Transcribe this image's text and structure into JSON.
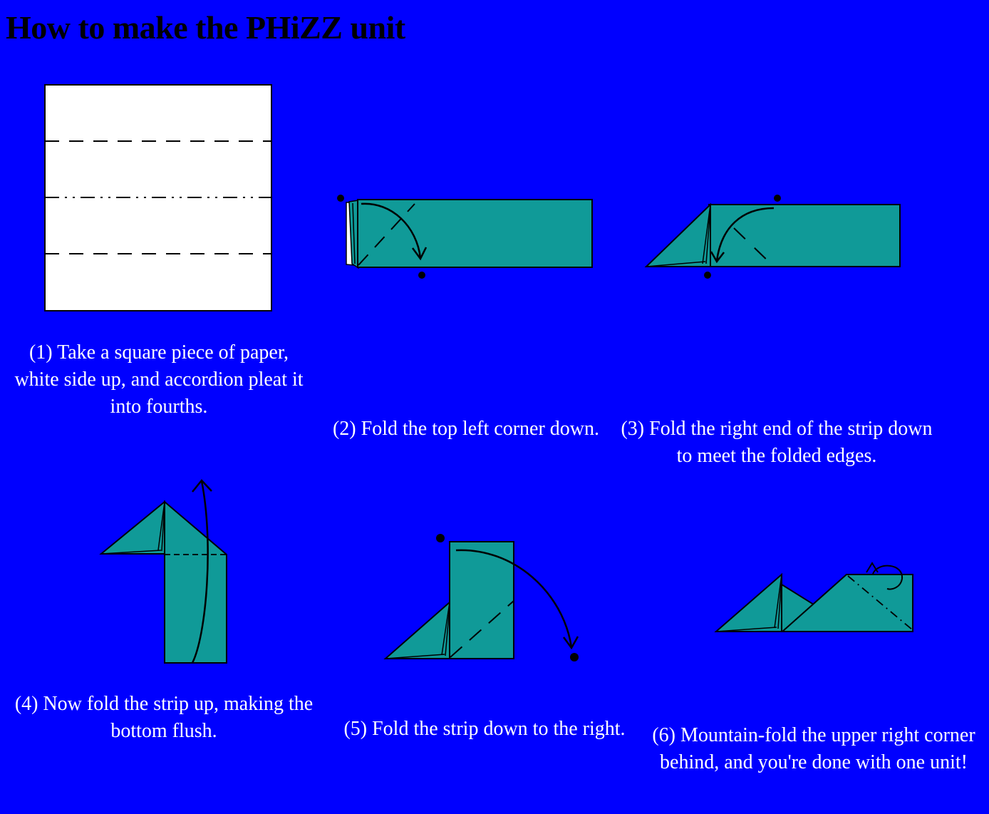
{
  "title": "How to make the PHiZZ unit",
  "colors": {
    "background": "#0000ff",
    "paper_colored": "#109a98",
    "paper_white": "#ffffff",
    "ink": "#000000",
    "caption_text": "#ffffff"
  },
  "steps": [
    {
      "number": 1,
      "caption": "(1) Take a square piece of paper, white side up, and accordion pleat it into fourths."
    },
    {
      "number": 2,
      "caption": "(2) Fold the top left corner down."
    },
    {
      "number": 3,
      "caption": "(3) Fold the right end of the strip down to meet the folded edges."
    },
    {
      "number": 4,
      "caption": "(4) Now fold the strip up, making the bottom flush."
    },
    {
      "number": 5,
      "caption": "(5) Fold the strip down to the right."
    },
    {
      "number": 6,
      "caption": "(6) Mountain-fold the upper right corner behind, and you're done with one unit!"
    }
  ]
}
